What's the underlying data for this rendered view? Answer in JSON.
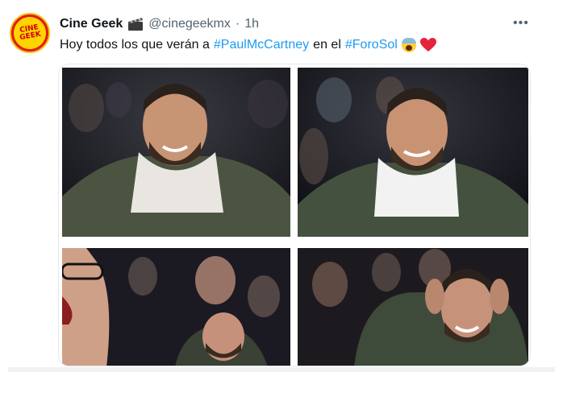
{
  "tweet": {
    "avatar_text_line1": "CINE",
    "avatar_text_line2": "GEEK",
    "author_name": "Cine Geek",
    "handle": "@cinegeekmx",
    "separator": "·",
    "time": "1h",
    "more_label": "•••",
    "text_prefix": "Hoy todos los que verán a",
    "hashtag_1": "#PaulMcCartney",
    "text_middle": "en el",
    "hashtag_2": "#ForoSol",
    "emojis": [
      "face-screaming-emoji",
      "red-heart-emoji"
    ]
  },
  "media": {
    "photos": [
      {
        "description": "smiling man in green parka with white hood in concert crowd"
      },
      {
        "description": "smiling man in green parka in crowd, people cheering behind"
      },
      {
        "description": "man with glasses laughing, smiling man in front row"
      },
      {
        "description": "man holding head with hands, smiling in crowd"
      }
    ]
  },
  "colors": {
    "link": "#1d9bf0",
    "secondary_text": "#536471",
    "primary_text": "#0f1419"
  }
}
